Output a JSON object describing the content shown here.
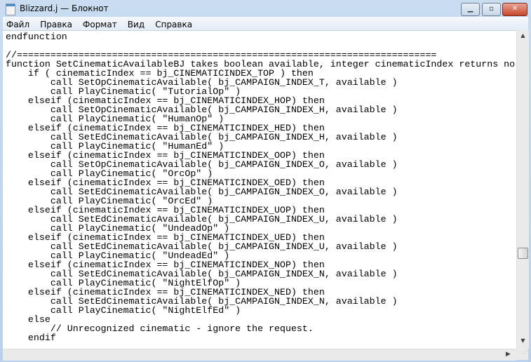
{
  "window": {
    "title": "Blizzard.j — Блокнот",
    "minimize": "▁",
    "maximize": "▫",
    "close": "✕"
  },
  "menu": [
    "Файл",
    "Правка",
    "Формат",
    "Вид",
    "Справка"
  ],
  "editor": {
    "lines": [
      "endfunction",
      "",
      "//===========================================================================",
      "function SetCinematicAvailableBJ takes boolean available, integer cinematicIndex returns no",
      "    if ( cinematicIndex == bj_CINEMATICINDEX_TOP ) then",
      "        call SetOpCinematicAvailable( bj_CAMPAIGN_INDEX_T, available )",
      "        call PlayCinematic( \"TutorialOp\" )",
      "    elseif (cinematicIndex == bj_CINEMATICINDEX_HOP) then",
      "        call SetOpCinematicAvailable( bj_CAMPAIGN_INDEX_H, available )",
      "        call PlayCinematic( \"HumanOp\" )",
      "    elseif (cinematicIndex == bj_CINEMATICINDEX_HED) then",
      "        call SetEdCinematicAvailable( bj_CAMPAIGN_INDEX_H, available )",
      "        call PlayCinematic( \"HumanEd\" )",
      "    elseif (cinematicIndex == bj_CINEMATICINDEX_OOP) then",
      "        call SetOpCinematicAvailable( bj_CAMPAIGN_INDEX_O, available )",
      "        call PlayCinematic( \"OrcOp\" )",
      "    elseif (cinematicIndex == bj_CINEMATICINDEX_OED) then",
      "        call SetEdCinematicAvailable( bj_CAMPAIGN_INDEX_O, available )",
      "        call PlayCinematic( \"OrcEd\" )",
      "    elseif (cinematicIndex == bj_CINEMATICINDEX_UOP) then",
      "        call SetEdCinematicAvailable( bj_CAMPAIGN_INDEX_U, available )",
      "        call PlayCinematic( \"UndeadOp\" )",
      "    elseif (cinematicIndex == bj_CINEMATICINDEX_UED) then",
      "        call SetEdCinematicAvailable( bj_CAMPAIGN_INDEX_U, available )",
      "        call PlayCinematic( \"UndeadEd\" )",
      "    elseif (cinematicIndex == bj_CINEMATICINDEX_NOP) then",
      "        call SetEdCinematicAvailable( bj_CAMPAIGN_INDEX_N, available )",
      "        call PlayCinematic( \"NightElfOp\" )",
      "    elseif (cinematicIndex == bj_CINEMATICINDEX_NED) then",
      "        call SetEdCinematicAvailable( bj_CAMPAIGN_INDEX_N, available )",
      "        call PlayCinematic( \"NightElfEd\" )",
      "    else",
      "        // Unrecognized cinematic - ignore the request.",
      "    endif"
    ]
  }
}
